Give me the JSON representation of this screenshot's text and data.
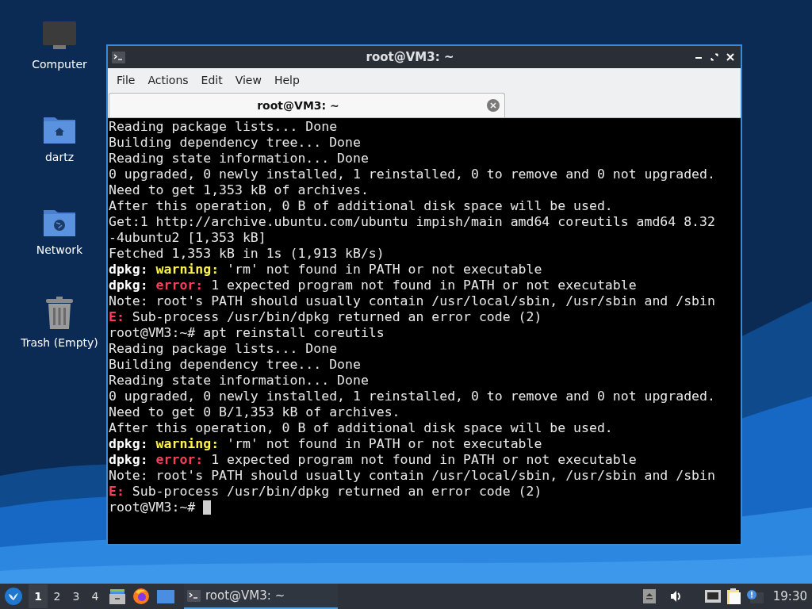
{
  "desktop_icons": [
    {
      "kind": "computer",
      "label": "Computer"
    },
    {
      "kind": "home",
      "label": "dartz"
    },
    {
      "kind": "network",
      "label": "Network"
    },
    {
      "kind": "trash",
      "label": "Trash (Empty)"
    }
  ],
  "window": {
    "title": "root@VM3: ~",
    "menu": [
      "File",
      "Actions",
      "Edit",
      "View",
      "Help"
    ],
    "tabs": [
      {
        "label": "root@VM3: ~",
        "selected": true
      }
    ],
    "terminal_lines": [
      [
        {
          "text": "Reading package lists... Done",
          "kind": "plain"
        }
      ],
      [
        {
          "text": "Building dependency tree... Done",
          "kind": "plain"
        }
      ],
      [
        {
          "text": "Reading state information... Done",
          "kind": "plain"
        }
      ],
      [
        {
          "text": "0 upgraded, 0 newly installed, 1 reinstalled, 0 to remove and 0 not upgraded.",
          "kind": "plain"
        }
      ],
      [
        {
          "text": "Need to get 1,353 kB of archives.",
          "kind": "plain"
        }
      ],
      [
        {
          "text": "After this operation, 0 B of additional disk space will be used.",
          "kind": "plain"
        }
      ],
      [
        {
          "text": "Get:1 http://archive.ubuntu.com/ubuntu impish/main amd64 coreutils amd64 8.32",
          "kind": "plain"
        }
      ],
      [
        {
          "text": "-4ubuntu2 [1,353 kB]",
          "kind": "plain"
        }
      ],
      [
        {
          "text": "Fetched 1,353 kB in 1s (1,913 kB/s)",
          "kind": "plain"
        }
      ],
      [
        {
          "text": "dpkg: ",
          "kind": "label"
        },
        {
          "text": "warning:",
          "kind": "warning"
        },
        {
          "text": " 'rm' not found in PATH or not executable",
          "kind": "plain"
        }
      ],
      [
        {
          "text": "dpkg: ",
          "kind": "label"
        },
        {
          "text": "error:",
          "kind": "error"
        },
        {
          "text": " 1 expected program not found in PATH or not executable",
          "kind": "plain"
        }
      ],
      [
        {
          "text": "Note: root's PATH should usually contain /usr/local/sbin, /usr/sbin and /sbin",
          "kind": "plain"
        }
      ],
      [
        {
          "text": "E:",
          "kind": "error"
        },
        {
          "text": " Sub-process /usr/bin/dpkg returned an error code (2)",
          "kind": "plain"
        }
      ],
      [
        {
          "text": "root@VM3:~# apt reinstall coreutils",
          "kind": "plain"
        }
      ],
      [
        {
          "text": "Reading package lists... Done",
          "kind": "plain"
        }
      ],
      [
        {
          "text": "Building dependency tree... Done",
          "kind": "plain"
        }
      ],
      [
        {
          "text": "Reading state information... Done",
          "kind": "plain"
        }
      ],
      [
        {
          "text": "0 upgraded, 0 newly installed, 1 reinstalled, 0 to remove and 0 not upgraded.",
          "kind": "plain"
        }
      ],
      [
        {
          "text": "Need to get 0 B/1,353 kB of archives.",
          "kind": "plain"
        }
      ],
      [
        {
          "text": "After this operation, 0 B of additional disk space will be used.",
          "kind": "plain"
        }
      ],
      [
        {
          "text": "dpkg: ",
          "kind": "label"
        },
        {
          "text": "warning:",
          "kind": "warning"
        },
        {
          "text": " 'rm' not found in PATH or not executable",
          "kind": "plain"
        }
      ],
      [
        {
          "text": "dpkg: ",
          "kind": "label"
        },
        {
          "text": "error:",
          "kind": "error"
        },
        {
          "text": " 1 expected program not found in PATH or not executable",
          "kind": "plain"
        }
      ],
      [
        {
          "text": "Note: root's PATH should usually contain /usr/local/sbin, /usr/sbin and /sbin",
          "kind": "plain"
        }
      ],
      [
        {
          "text": "E:",
          "kind": "error"
        },
        {
          "text": " Sub-process /usr/bin/dpkg returned an error code (2)",
          "kind": "plain"
        }
      ],
      [
        {
          "text": "root@VM3:~# ",
          "kind": "plain"
        }
      ]
    ],
    "cursor_visible": true
  },
  "taskbar": {
    "workspaces": [
      {
        "label": "1",
        "selected": true
      },
      {
        "label": "2",
        "selected": false
      },
      {
        "label": "3",
        "selected": false
      },
      {
        "label": "4",
        "selected": false
      }
    ],
    "tasks": [
      {
        "label": "root@VM3: ~",
        "selected": true
      }
    ],
    "clock": "19:30"
  }
}
